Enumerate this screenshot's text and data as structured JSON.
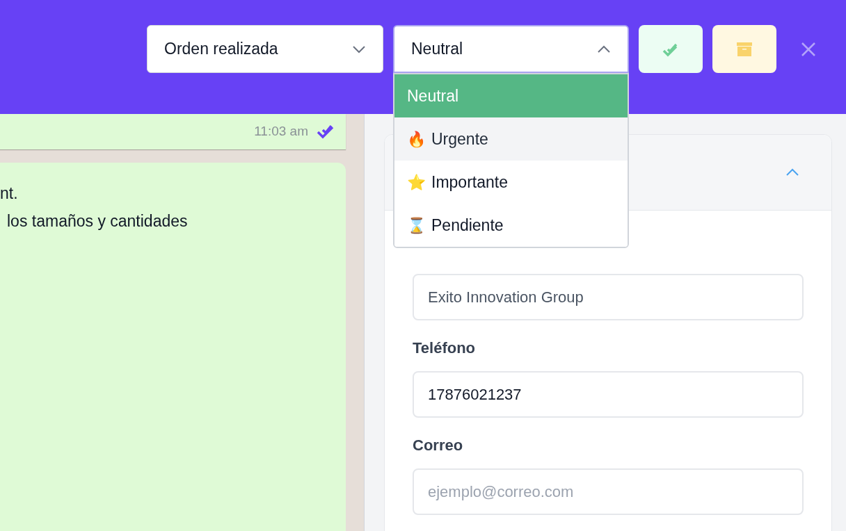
{
  "header": {
    "status_select": {
      "value": "Orden realizada",
      "expanded": false
    },
    "priority_select": {
      "value": "Neutral",
      "expanded": true,
      "options": [
        {
          "label": "Neutral",
          "selected": true,
          "hovered": false
        },
        {
          "icon": "🔥",
          "label": "Urgente",
          "selected": false,
          "hovered": true
        },
        {
          "icon": "⭐",
          "label": "Importante",
          "selected": false,
          "hovered": false
        },
        {
          "icon": "⌛",
          "label": "Pendiente",
          "selected": false,
          "hovered": false
        }
      ]
    }
  },
  "chat": {
    "messages": [
      {
        "time": "11:03 am",
        "read": true
      },
      {
        "lines": [
          "nt.",
          "los tamaños y cantidades"
        ]
      }
    ]
  },
  "contact_panel": {
    "expanded": true,
    "fields": [
      {
        "value": "Exito Innovation Group"
      },
      {
        "label": "Teléfono",
        "value": "17876021237"
      },
      {
        "label": "Correo",
        "placeholder": "ejemplo@correo.com"
      }
    ]
  }
}
